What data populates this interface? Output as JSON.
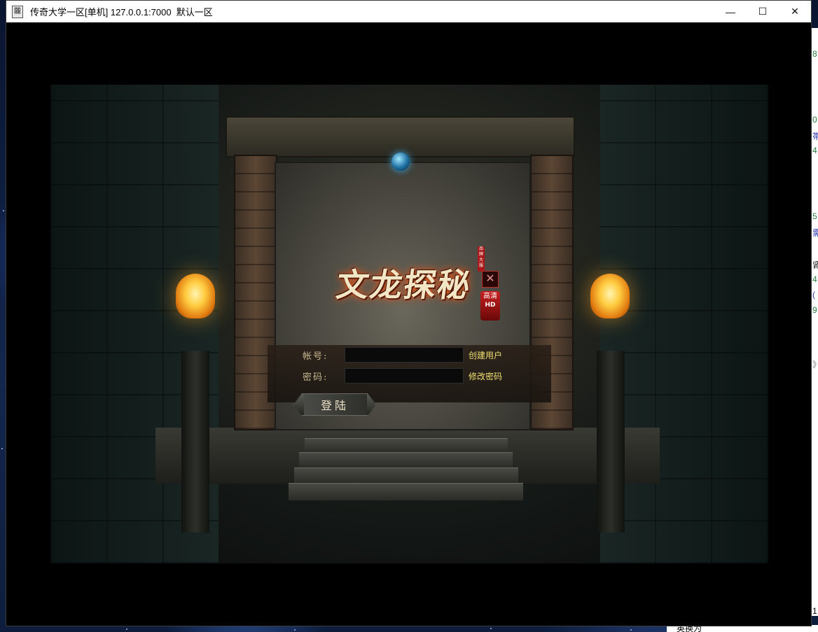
{
  "window": {
    "title": "传奇大学一区[单机] 127.0.0.1:7000  默认一区",
    "icon": "game-app-icon",
    "icon_glyph": "龖",
    "controls": {
      "minimize": "—",
      "maximize": "☐",
      "close": "✕"
    }
  },
  "game": {
    "logo": {
      "text": "文龙探秘",
      "tag": "品牌大服"
    },
    "hd_badge": {
      "line1": "高",
      "line2": "清",
      "line3": "HD"
    },
    "close_glyph": "✕",
    "login": {
      "account_label": "帐号:",
      "password_label": "密码:",
      "account_value": "",
      "password_value": "",
      "create_user": "创建用户",
      "change_password": "修改密码",
      "login_button": "登陆"
    }
  },
  "background_window": {
    "fragments": [
      "8",
      "0",
      "帯",
      "4",
      "5",
      "需",
      "肾",
      "4",
      "(",
      "9",
      "》",
      "1"
    ],
    "bottom_text": "英换为"
  },
  "colors": {
    "link": "#f0e070",
    "label": "#c9b78f",
    "lamp": "#ffcc40",
    "gem": "#1d6fa0"
  }
}
